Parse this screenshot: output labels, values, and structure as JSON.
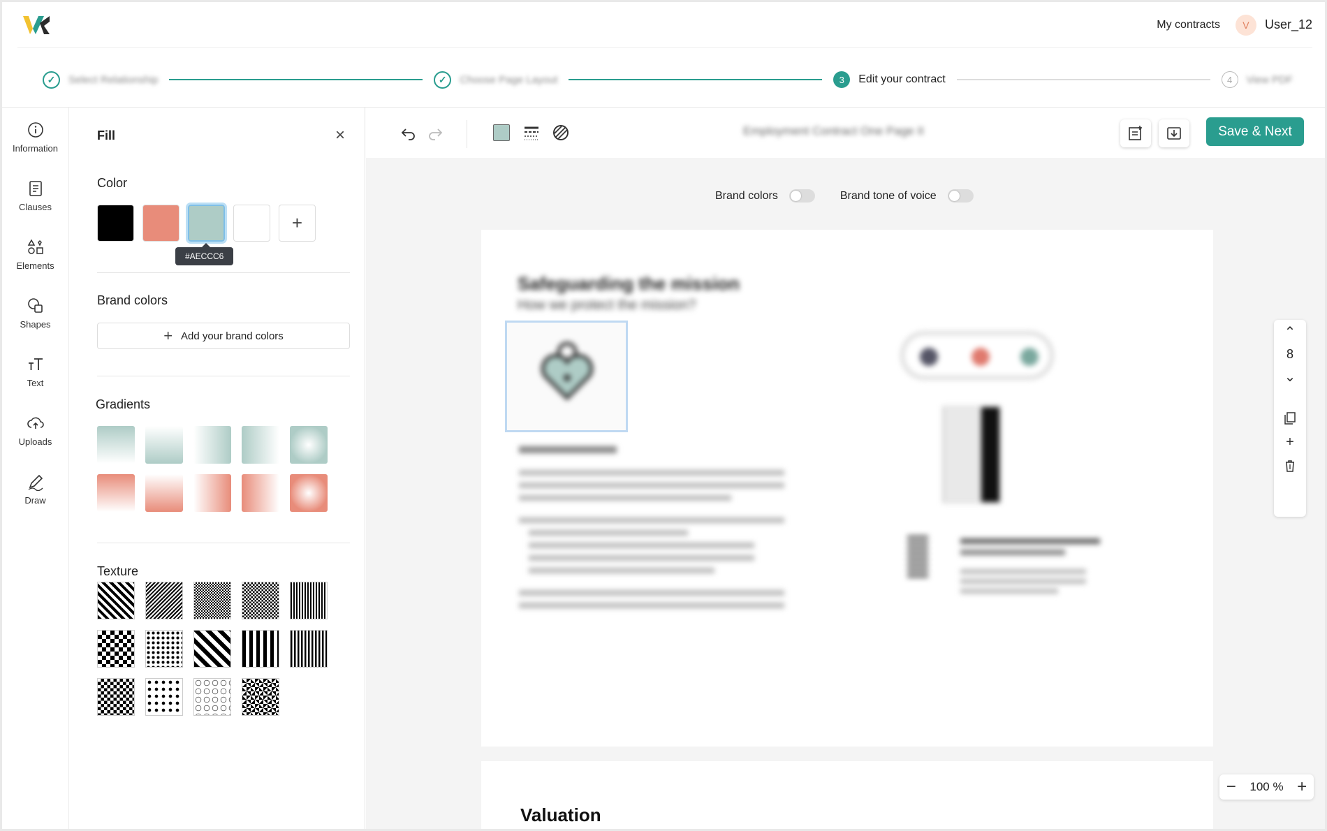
{
  "header": {
    "my_contracts": "My contracts",
    "avatar_letter": "V",
    "username": "User_12"
  },
  "stepper": {
    "steps": [
      {
        "label": "Select Relationship",
        "state": "done"
      },
      {
        "label": "Choose Page Layout",
        "state": "done"
      },
      {
        "number": "3",
        "label": "Edit your contract",
        "state": "active"
      },
      {
        "number": "4",
        "label": "View PDF",
        "state": "pending"
      }
    ]
  },
  "rail": {
    "items": [
      {
        "label": "Information",
        "icon": "info-icon"
      },
      {
        "label": "Clauses",
        "icon": "document-icon"
      },
      {
        "label": "Elements",
        "icon": "elements-icon"
      },
      {
        "label": "Shapes",
        "icon": "shapes-icon"
      },
      {
        "label": "Text",
        "icon": "text-icon"
      },
      {
        "label": "Uploads",
        "icon": "cloud-upload-icon"
      },
      {
        "label": "Draw",
        "icon": "pen-icon"
      }
    ]
  },
  "panel": {
    "title": "Fill",
    "color_title": "Color",
    "colors": [
      "#000000",
      "#E88C7A",
      "#AECCC6",
      "#FFFFFF"
    ],
    "tooltip": "#AECCC6",
    "brand_title": "Brand colors",
    "brand_button": "Add your brand colors",
    "gradients_title": "Gradients",
    "texture_title": "Texture"
  },
  "toolbar": {
    "doc_title": "Employment Contract One Page II",
    "save_label": "Save & Next",
    "fill_color": "#AECCC6"
  },
  "canvas": {
    "brand_colors_label": "Brand colors",
    "brand_tone_label": "Brand tone of voice",
    "page_heading": "Safeguarding the mission",
    "page_subheading": "How we protect the mission?",
    "page2_heading": "Valuation",
    "page_number": "8",
    "zoom": "100 %"
  },
  "accent": "#2A9D8F"
}
